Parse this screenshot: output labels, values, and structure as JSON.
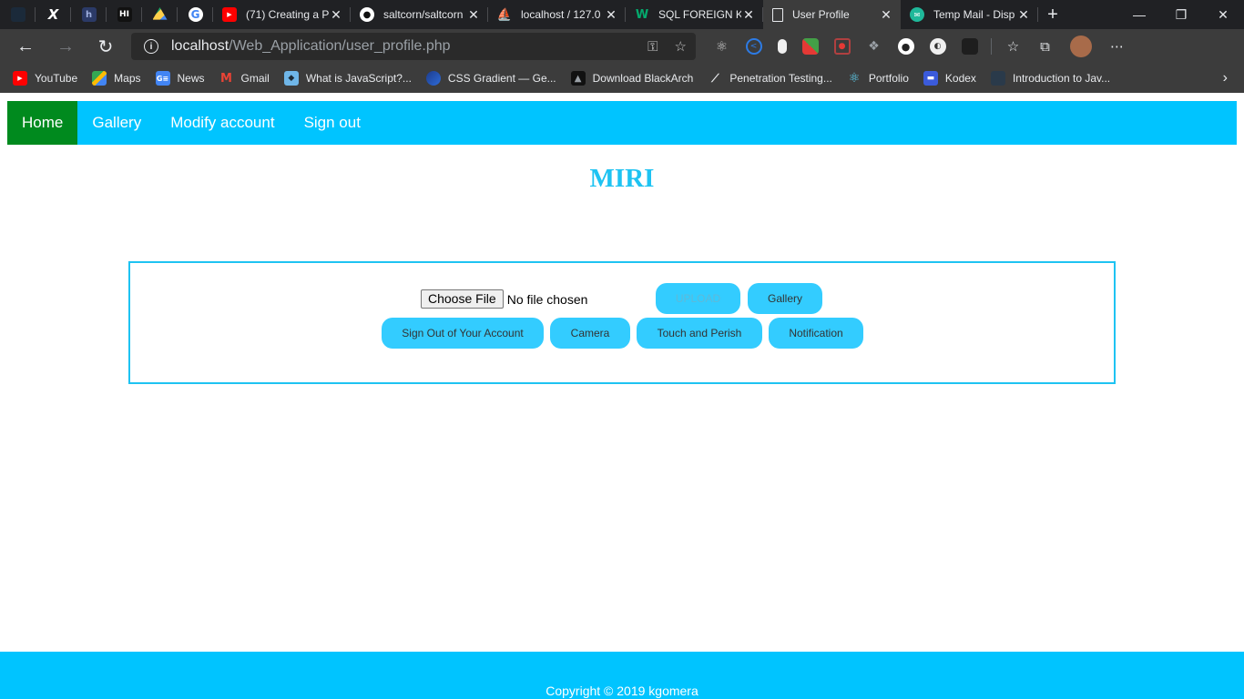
{
  "browser": {
    "pinned_tabs": [
      {
        "icon": "blank-dark-icon",
        "color": "#1b2a3a"
      },
      {
        "icon": "x-icon",
        "color": "#202124"
      },
      {
        "icon": "h-square-icon",
        "color": "#2b3a67"
      },
      {
        "icon": "hashnode-icon",
        "color": "#111111"
      },
      {
        "icon": "google-drive-icon",
        "color": "#1fa463"
      },
      {
        "icon": "google-icon",
        "color": "#ffffff"
      }
    ],
    "tabs": [
      {
        "title": "(71) Creating a P",
        "icon": "youtube-icon",
        "color": "#ff0000"
      },
      {
        "title": "saltcorn/saltcorn",
        "icon": "github-icon",
        "color": "#ffffff"
      },
      {
        "title": "localhost / 127.0",
        "icon": "phpmyadmin-icon",
        "color": "#f29111"
      },
      {
        "title": "SQL FOREIGN KE",
        "icon": "w3schools-icon",
        "color": "#04aa6d"
      },
      {
        "title": "User Profile",
        "icon": "page-icon",
        "color": "#e8eaed",
        "active": true
      },
      {
        "title": "Temp Mail - Disp",
        "icon": "tempmail-icon",
        "color": "#1fb89a"
      }
    ],
    "address": {
      "host": "localhost",
      "path": "/Web_Application/user_profile.php"
    },
    "bookmarks": [
      {
        "label": "YouTube",
        "icon": "youtube-icon",
        "color": "#ff0000"
      },
      {
        "label": "Maps",
        "icon": "maps-icon",
        "color": "#34a853"
      },
      {
        "label": "News",
        "icon": "google-news-icon",
        "color": "#4285f4"
      },
      {
        "label": "Gmail",
        "icon": "gmail-icon",
        "color": "#ea4335"
      },
      {
        "label": "What is JavaScript?...",
        "icon": "bookmark-icon",
        "color": "#6fb6e8"
      },
      {
        "label": "CSS Gradient — Ge...",
        "icon": "gradient-icon",
        "color": "#2d6bd8"
      },
      {
        "label": "Download BlackArch",
        "icon": "blackarch-icon",
        "color": "#111111"
      },
      {
        "label": "Penetration Testing...",
        "icon": "kali-icon",
        "color": "#222222"
      },
      {
        "label": "Portfolio",
        "icon": "react-icon",
        "color": "#2a2a2a"
      },
      {
        "label": "Kodex",
        "icon": "kodex-icon",
        "color": "#3b5bdb"
      },
      {
        "label": "Introduction to Jav...",
        "icon": "blank-bookmark-icon",
        "color": "#2a3a4a"
      }
    ]
  },
  "page": {
    "nav": [
      {
        "label": "Home",
        "active": true
      },
      {
        "label": "Gallery"
      },
      {
        "label": "Modify account"
      },
      {
        "label": "Sign out"
      }
    ],
    "username": "MIRI",
    "file_input": {
      "button": "Choose File",
      "status": "No file chosen"
    },
    "buttons": {
      "upload": "UPLOAD",
      "gallery": "Gallery",
      "sign_out": "Sign Out of Your Account",
      "camera": "Camera",
      "touch": "Touch and Perish",
      "notification": "Notification"
    },
    "footer": "Copyright © 2019 kgomera"
  },
  "colors": {
    "accent": "#00c4ff",
    "nav_active": "#008a1e",
    "title": "#1ec3f2"
  }
}
